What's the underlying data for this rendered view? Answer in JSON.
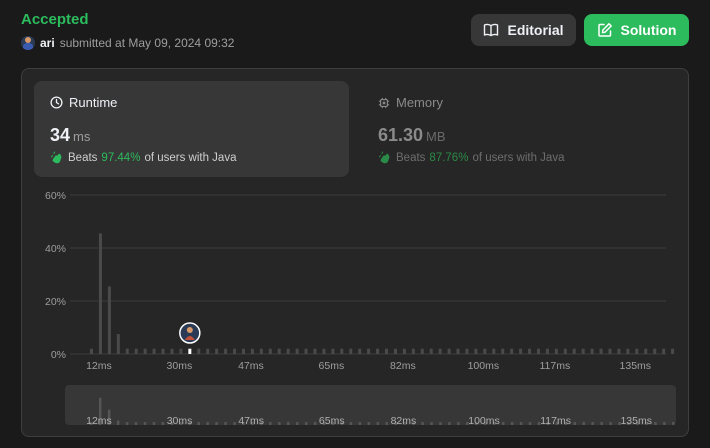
{
  "header": {
    "status": "Accepted",
    "user": "ari",
    "submitted_text": "submitted at May 09, 2024 09:32",
    "editorial_label": "Editorial",
    "solution_label": "Solution"
  },
  "runtime": {
    "title": "Runtime",
    "value": "34",
    "unit": "ms",
    "beats_label": "Beats",
    "beats_pct": "97.44%",
    "beats_suffix": "of users with Java"
  },
  "memory": {
    "title": "Memory",
    "value": "61.30",
    "unit": "MB",
    "beats_label": "Beats",
    "beats_pct": "87.76%",
    "beats_suffix": "of users with Java"
  },
  "colors": {
    "accent": "#2cbb5d",
    "bar": "#4a4a4a",
    "bar_highlight": "#ffffff"
  },
  "chart_data": {
    "type": "bar",
    "ylim": [
      0,
      60
    ],
    "yticks": [
      "0%",
      "20%",
      "40%",
      "60%"
    ],
    "ytick_values": [
      0,
      20,
      40,
      60
    ],
    "xlabels": [
      "12ms",
      "30ms",
      "47ms",
      "65ms",
      "82ms",
      "100ms",
      "117ms",
      "135ms"
    ],
    "xlabel_indices": [
      1,
      10,
      18,
      27,
      35,
      44,
      52,
      61
    ],
    "values": [
      2,
      45.5,
      25.5,
      7.5,
      2,
      2,
      2,
      2,
      2,
      2,
      2,
      2,
      2,
      2,
      2,
      2,
      2,
      2,
      2,
      2,
      2,
      2,
      2,
      2,
      2,
      2,
      2,
      2,
      2,
      2,
      2,
      2,
      2,
      2,
      2,
      2,
      2,
      2,
      2,
      2,
      2,
      2,
      2,
      2,
      2,
      2,
      2,
      2,
      2,
      2,
      2,
      2,
      2,
      2,
      2,
      2,
      2,
      2,
      2,
      2,
      2,
      2,
      2,
      2,
      2,
      2
    ],
    "highlight_index": 11,
    "mini_xlabels": [
      "12ms",
      "30ms",
      "47ms",
      "65ms",
      "82ms",
      "100ms",
      "117ms",
      "135ms"
    ]
  }
}
